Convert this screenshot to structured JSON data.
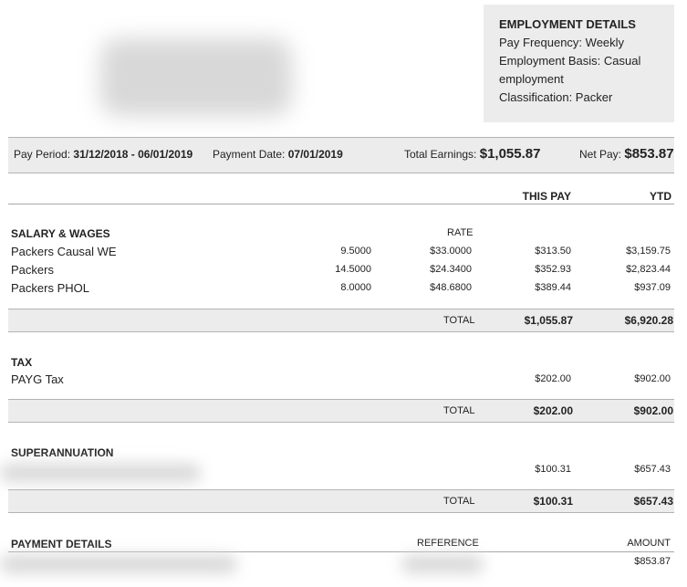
{
  "employment": {
    "heading": "EMPLOYMENT DETAILS",
    "line1": "Pay Frequency: Weekly",
    "line2": "Employment Basis: Casual",
    "line3": "employment",
    "line4": "Classification: Packer"
  },
  "summary": {
    "pay_period_label": "Pay Period:",
    "pay_period_value": "31/12/2018 - 06/01/2019",
    "payment_date_label": "Payment Date:",
    "payment_date_value": "07/01/2019",
    "total_earnings_label": "Total Earnings:",
    "total_earnings_value": "$1,055.87",
    "net_pay_label": "Net Pay:",
    "net_pay_value": "$853.87"
  },
  "columns": {
    "this_pay": "THIS PAY",
    "ytd": "YTD",
    "rate": "RATE",
    "total": "TOTAL"
  },
  "salary": {
    "heading": "SALARY & WAGES",
    "rows": [
      {
        "label": "Packers Causal WE",
        "hours": "9.5000",
        "rate": "$33.0000",
        "this_pay": "$313.50",
        "ytd": "$3,159.75"
      },
      {
        "label": "Packers",
        "hours": "14.5000",
        "rate": "$24.3400",
        "this_pay": "$352.93",
        "ytd": "$2,823.44"
      },
      {
        "label": "Packers PHOL",
        "hours": "8.0000",
        "rate": "$48.6800",
        "this_pay": "$389.44",
        "ytd": "$937.09"
      }
    ],
    "total_this_pay": "$1,055.87",
    "total_ytd": "$6,920.28"
  },
  "tax": {
    "heading": "TAX",
    "rows": [
      {
        "label": "PAYG Tax",
        "this_pay": "$202.00",
        "ytd": "$902.00"
      }
    ],
    "total_this_pay": "$202.00",
    "total_ytd": "$902.00"
  },
  "super": {
    "heading": "SUPERANNUATION",
    "this_pay": "$100.31",
    "ytd": "$657.43",
    "total_this_pay": "$100.31",
    "total_ytd": "$657.43"
  },
  "payment": {
    "heading": "PAYMENT DETAILS",
    "reference_label": "REFERENCE",
    "amount_label": "AMOUNT",
    "amount": "$853.87"
  }
}
